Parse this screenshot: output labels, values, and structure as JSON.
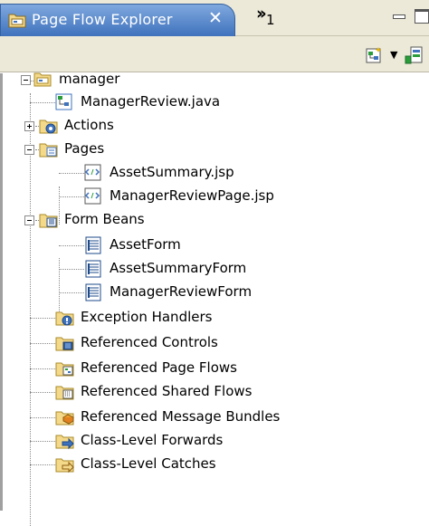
{
  "view": {
    "title": "Page Flow Explorer",
    "overflow_count": "1",
    "close_glyph": "✕"
  },
  "toolbar": {
    "buttons": [
      "new-page-flow-icon",
      "dropdown-arrow-icon",
      "refresh-view-icon"
    ]
  },
  "tree": {
    "root": "manager",
    "items": [
      {
        "label": "ManagerReview.java",
        "icon": "java-class-icon"
      },
      {
        "label": "Actions",
        "icon": "actions-folder-icon"
      },
      {
        "label": "Pages",
        "icon": "pages-folder-icon"
      },
      {
        "label": "AssetSummary.jsp",
        "icon": "jsp-file-icon"
      },
      {
        "label": "ManagerReviewPage.jsp",
        "icon": "jsp-file-icon"
      },
      {
        "label": "Form Beans",
        "icon": "form-beans-folder-icon"
      },
      {
        "label": "AssetForm",
        "icon": "form-bean-icon"
      },
      {
        "label": "AssetSummaryForm",
        "icon": "form-bean-icon"
      },
      {
        "label": "ManagerReviewForm",
        "icon": "form-bean-icon"
      },
      {
        "label": "Exception Handlers",
        "icon": "exception-handlers-folder-icon"
      },
      {
        "label": "Referenced Controls",
        "icon": "controls-folder-icon"
      },
      {
        "label": "Referenced Page Flows",
        "icon": "page-flows-folder-icon"
      },
      {
        "label": "Referenced Shared Flows",
        "icon": "shared-flows-folder-icon"
      },
      {
        "label": "Referenced Message Bundles",
        "icon": "message-bundles-folder-icon"
      },
      {
        "label": "Class-Level Forwards",
        "icon": "forwards-folder-icon"
      },
      {
        "label": "Class-Level Catches",
        "icon": "catches-folder-icon"
      }
    ]
  }
}
